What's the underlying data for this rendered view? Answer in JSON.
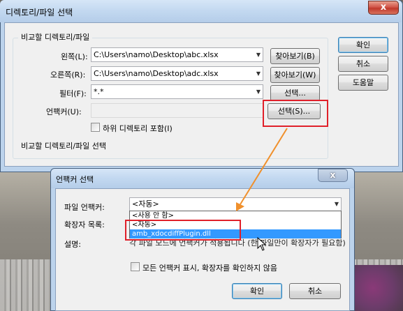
{
  "main_dialog": {
    "title": "디렉토리/파일 선택",
    "close_label": "x",
    "group_title": "비교할 디렉토리/파일",
    "left": {
      "label": "왼쪽(L):",
      "value": "C:\\Users\\namo\\Desktop\\abc.xlsx",
      "browse_label": "찾아보기(B)"
    },
    "right": {
      "label": "오른쪽(R):",
      "value": "C:\\Users\\namo\\Desktop\\adc.xlsx",
      "browse_label": "찾아보기(W)"
    },
    "filter": {
      "label": "필터(F):",
      "value": "*.*",
      "select_label": "선택..."
    },
    "unpacker": {
      "label": "언팩커(U):",
      "value": "",
      "select_label": "선택(S)..."
    },
    "include_subdirs_label": "하위 디렉토리 포함(I)",
    "status_text": "비교할 디렉토리/파일 선택",
    "buttons": {
      "ok": "확인",
      "cancel": "취소",
      "help": "도움말"
    }
  },
  "unpacker_dialog": {
    "title": "언팩커 선택",
    "close_label": "x",
    "file_unpacker_label": "파일 언팩커:",
    "file_unpacker_value": "<자동>",
    "extensions_label": "확장자 목록:",
    "description_label": "설명:",
    "description_text": "각 파일 모드에 언팩커가 적용됩니다 (한 파일만이 확장자가 필요함)",
    "dropdown_options": [
      "<사용 안 함>",
      "<자동>",
      "amb_xdocdiffPlugin.dll"
    ],
    "dropdown_selected_index": 2,
    "show_all_label": "모든 언팩커 표시, 확장자를 확인하지 않음",
    "buttons": {
      "ok": "확인",
      "cancel": "취소"
    }
  },
  "colors": {
    "highlight": "#e0202a",
    "arrow": "#f0902c",
    "selection": "#3399ff"
  },
  "icons": {
    "cursor": "mouse-pointer-icon",
    "arrow": "annotation-arrow",
    "dropdown": "chevron-down-icon"
  }
}
